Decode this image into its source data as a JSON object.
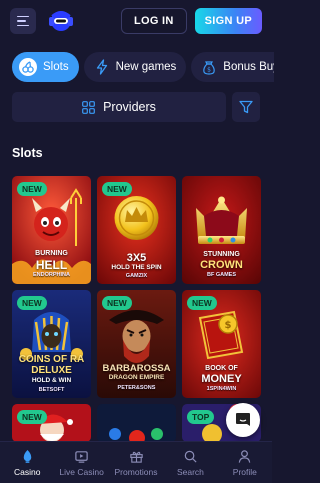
{
  "header": {
    "login_label": "LOG IN",
    "signup_label": "SIGN UP"
  },
  "tabs": [
    {
      "label": "Slots",
      "icon": "cherry-icon",
      "active": true
    },
    {
      "label": "New games",
      "icon": "lightning-icon",
      "active": false
    },
    {
      "label": "Bonus Buy",
      "icon": "bonus-bag-icon",
      "active": false
    }
  ],
  "providers": {
    "label": "Providers",
    "icon": "grid-icon"
  },
  "filter": {
    "icon": "filter-icon"
  },
  "section": {
    "title": "Slots"
  },
  "games": [
    {
      "badge": "NEW",
      "title_line1": "BURNING",
      "title_line2": "HELL",
      "provider": "ENDORPHINA"
    },
    {
      "badge": "NEW",
      "title_line1": "3X5",
      "title_line2": "HOLD THE SPIN",
      "provider": "GAMZIX"
    },
    {
      "badge": "",
      "title_line1": "STUNNING",
      "title_line2": "CROWN",
      "provider": "BF GAMES"
    },
    {
      "badge": "NEW",
      "title_line1": "COINS OF RA",
      "title_line2": "DELUXE",
      "title_line3": "HOLD & WIN",
      "provider": "BETSOFT"
    },
    {
      "badge": "NEW",
      "title_line1": "BARBAROSSA",
      "title_line2": "DRAGON EMPIRE",
      "provider": "PETER&SONS"
    },
    {
      "badge": "NEW",
      "title_line1": "BOOK OF",
      "title_line2": "MONEY",
      "provider": "1SPIN4WIN"
    },
    {
      "badge": "NEW"
    },
    {
      "badge": ""
    },
    {
      "badge": "TOP"
    }
  ],
  "bottom_nav": [
    {
      "label": "Casino",
      "icon": "casino-icon",
      "active": true
    },
    {
      "label": "Live Casino",
      "icon": "live-casino-icon",
      "active": false
    },
    {
      "label": "Promotions",
      "icon": "gift-icon",
      "active": false
    },
    {
      "label": "Search",
      "icon": "search-icon",
      "active": false
    },
    {
      "label": "Profile",
      "icon": "profile-icon",
      "active": false
    }
  ],
  "colors": {
    "background": "#17172f",
    "accent": "#3a9bf7",
    "badge_green": "#22c88e",
    "nav_inactive": "#8c8db7"
  }
}
